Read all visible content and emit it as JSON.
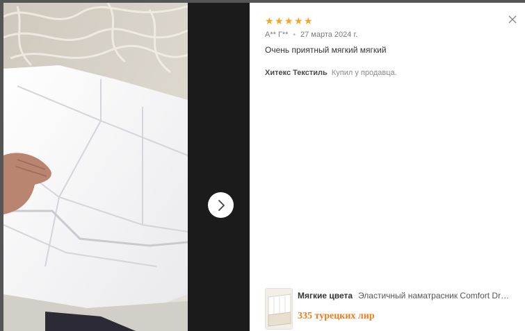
{
  "modal": {
    "close_icon": "close-icon",
    "next_icon": "chevron-right-icon"
  },
  "review": {
    "rating": 5,
    "star_icon": "star-icon",
    "star_color": "#f5a623",
    "author": "А** Г**",
    "date": "27 марта 2024 г.",
    "text": "Очень приятный мягкий мягкий"
  },
  "seller": {
    "name": "Хитекс Текстиль",
    "note": "Купил у продавца."
  },
  "product": {
    "brand": "Мягкие цвета",
    "name": "Эластичный наматрасник Comfort Dream",
    "price": "335 турецких лир",
    "price_color": "#f27a1a"
  }
}
